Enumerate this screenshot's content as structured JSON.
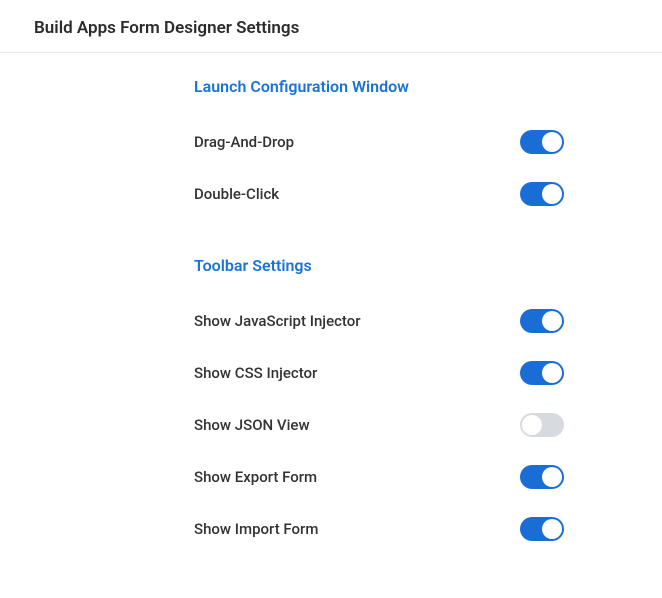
{
  "header": {
    "title": "Build Apps Form Designer Settings"
  },
  "sections": {
    "launch": {
      "title": "Launch Configuration Window",
      "drag_drop_label": "Drag-And-Drop",
      "drag_drop_on": true,
      "double_click_label": "Double-Click",
      "double_click_on": true
    },
    "toolbar": {
      "title": "Toolbar Settings",
      "js_injector_label": "Show JavaScript Injector",
      "js_injector_on": true,
      "css_injector_label": "Show CSS Injector",
      "css_injector_on": true,
      "json_view_label": "Show JSON View",
      "json_view_on": false,
      "export_form_label": "Show Export Form",
      "export_form_on": true,
      "import_form_label": "Show Import Form",
      "import_form_on": true
    }
  }
}
